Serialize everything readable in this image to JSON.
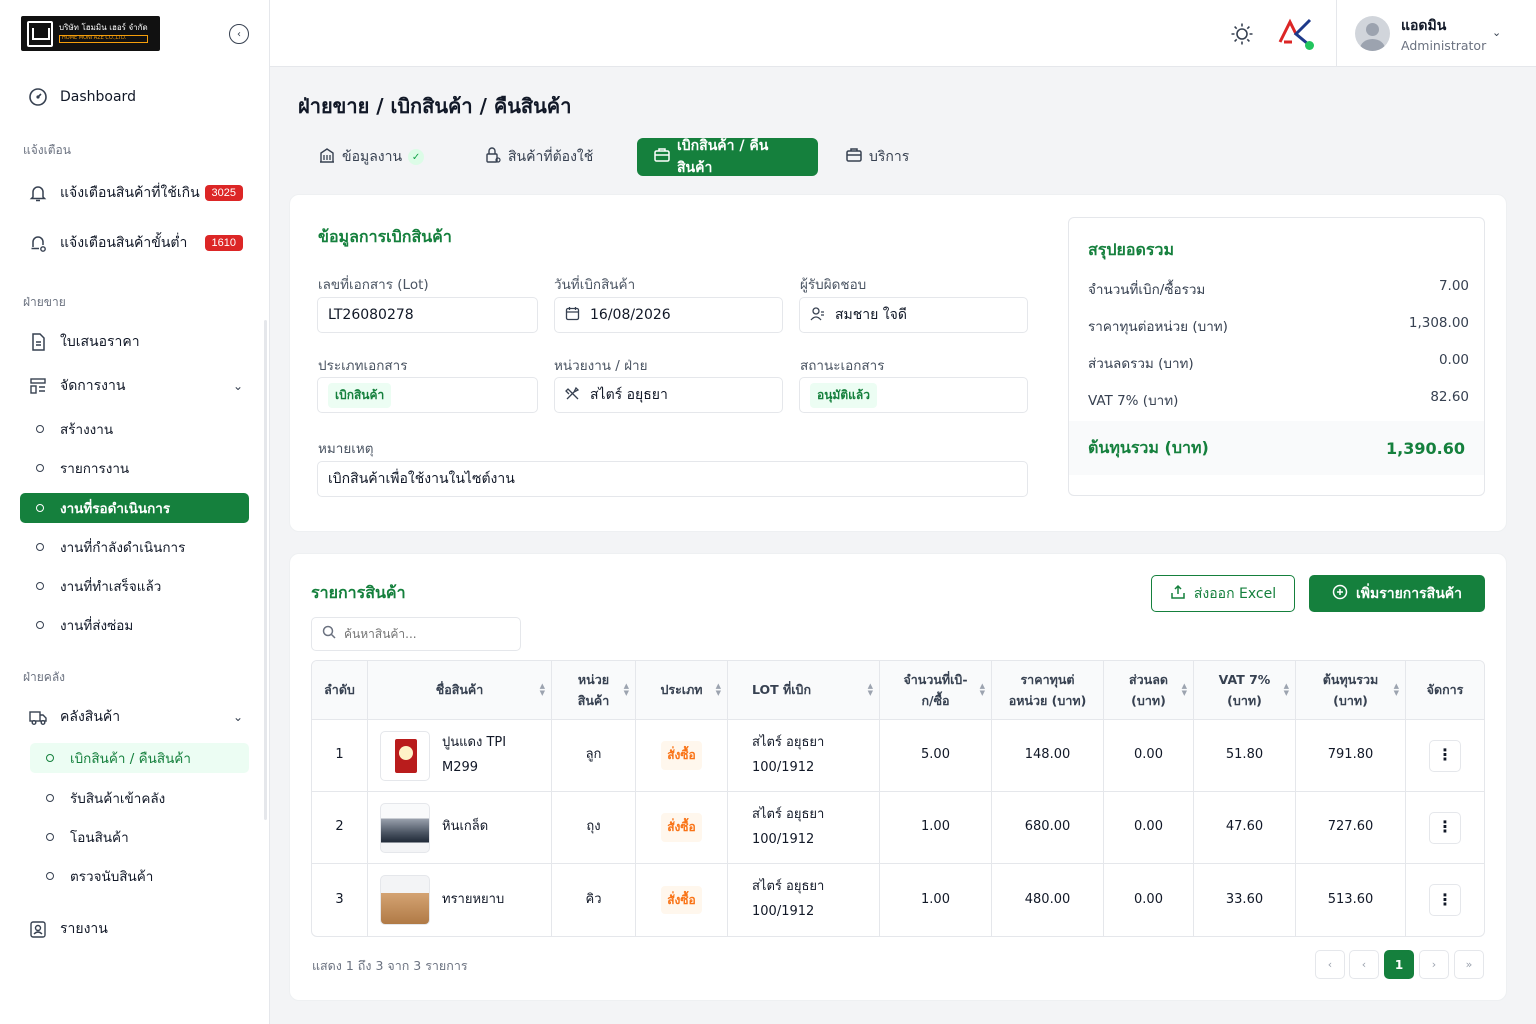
{
  "company": {
    "name_line1": "บริษัท โฮมมิน เฮอร์ จำกัด",
    "name_line2": "HOME MONI AZE CO.,LTD."
  },
  "sidebar": {
    "dashboard": "Dashboard",
    "section_alerts": "แจ้งเตือน",
    "alert_overuse": {
      "label": "แจ้งเตือนสินค้าที่ใช้เกิน",
      "count": "3025"
    },
    "alert_min": {
      "label": "แจ้งเตือนสินค้าขั้นต่ำ",
      "count": "1610"
    },
    "section_sales": "ฝ่ายขาย",
    "quotation": "ใบเสนอราคา",
    "manage_jobs": "จัดการงาน",
    "jobs": [
      "สร้างงาน",
      "รายการงาน",
      "งานที่รอดำเนินการ",
      "งานที่กำลังดำเนินการ",
      "งานที่ทำเสร็จแล้ว",
      "งานที่ส่งซ่อม"
    ],
    "section_warehouse": "ฝ่ายคลัง",
    "warehouse": "คลังสินค้า",
    "warehouse_items": [
      "เบิกสินค้า / คืนสินค้า",
      "รับสินค้าเข้าคลัง",
      "โอนสินค้า",
      "ตรวจนับสินค้า"
    ],
    "report": "รายงาน"
  },
  "user": {
    "name": "แอดมิน",
    "role": "Administrator"
  },
  "page": {
    "title": "ฝ่ายขาย / เบิกสินค้า / คืนสินค้า",
    "tabs": [
      "ข้อมูลงาน",
      "สินค้าที่ต้องใช้",
      "เบิกสินค้า / คืนสินค้า",
      "บริการ"
    ]
  },
  "info": {
    "title": "ข้อมูลการเบิกสินค้า",
    "lot_label": "เลขที่เอกสาร (Lot)",
    "lot_value": "LT26080278",
    "date_label": "วันที่เบิกสินค้า",
    "date_value": "16/08/2026",
    "owner_label": "ผู้รับผิดชอบ",
    "owner_value": "สมชาย ใจดี",
    "doctype_label": "ประเภทเอกสาร",
    "doctype_value": "เบิกสินค้า",
    "dept_label": "หน่วยงาน / ฝ่าย",
    "dept_value": "สไตร์ อยุธยา",
    "status_label": "สถานะเอกสาร",
    "status_value": "อนุมัติแล้ว",
    "note_label": "หมายเหตุ",
    "note_value": "เบิกสินค้าเพื่อใช้งานในไซต์งาน"
  },
  "summary": {
    "title": "สรุปยอดรวม",
    "rows": [
      {
        "label": "จำนวนที่เบิก/ซื้อรวม",
        "value": "7.00"
      },
      {
        "label": "ราคาทุนต่อหน่วย (บาท)",
        "value": "1,308.00"
      },
      {
        "label": "ส่วนลดรวม (บาท)",
        "value": "0.00"
      },
      {
        "label": "VAT 7% (บาท)",
        "value": "82.60"
      }
    ],
    "total_label": "ต้นทุนรวม (บาท)",
    "total_value": "1,390.60"
  },
  "items": {
    "title": "รายการสินค้า",
    "export_label": "ส่งออก Excel",
    "add_label": "เพิ่มรายการสินค้า",
    "search_placeholder": "ค้นหาสินค้า...",
    "headers": [
      "ลำดับ",
      "ชื่อสินค้า",
      "หน่วยสินค้า",
      "ประเภท",
      "LOT ที่เบิก",
      "จำนวนที่เบิก/ซื้อ",
      "ราคาทุนต่อหน่วย (บาท)",
      "ส่วนลด (บาท)",
      "VAT 7% (บาท)",
      "ต้นทุนรวม (บาท)",
      "จัดการ"
    ],
    "headers_l1": [
      "ลำดับ",
      "ชื่อสินค้า",
      "หน่วย",
      "ประเภท",
      "LOT ที่เบิก",
      "จำนวนที่เบิ-",
      "ราคาทุนต่",
      "ส่วนลด",
      "VAT 7%",
      "ต้นทุนรวม",
      "จัดการ"
    ],
    "headers_l2": [
      "",
      "",
      "สินค้า",
      "",
      "",
      "ก/ซื้อ",
      "อหน่วย (บาท)",
      "(บาท)",
      "(บาท)",
      "(บาท)",
      ""
    ],
    "rows": [
      {
        "no": "1",
        "name1": "ปูนแดง TPI",
        "name2": "M299",
        "unit": "ลูก",
        "type": "สั่งซื้อ",
        "lot1": "สไตร์ อยุธยา",
        "lot2": "100/1912",
        "qty": "5.00",
        "cost": "148.00",
        "disc": "0.00",
        "vat": "51.80",
        "total": "791.80",
        "img": "cement-bag"
      },
      {
        "no": "2",
        "name1": "หินเกล็ด",
        "name2": "",
        "unit": "ถุง",
        "type": "สั่งซื้อ",
        "lot1": "สไตร์ อยุธยา",
        "lot2": "100/1912",
        "qty": "1.00",
        "cost": "680.00",
        "disc": "0.00",
        "vat": "47.60",
        "total": "727.60",
        "img": "pipes"
      },
      {
        "no": "3",
        "name1": "ทรายหยาบ",
        "name2": "",
        "unit": "คิว",
        "type": "สั่งซื้อ",
        "lot1": "สไตร์ อยุธยา",
        "lot2": "100/1912",
        "qty": "1.00",
        "cost": "480.00",
        "disc": "0.00",
        "vat": "33.60",
        "total": "513.60",
        "img": "sand"
      }
    ],
    "footer": "แสดง 1 ถึง 3 จาก 3 รายการ",
    "page_current": "1"
  },
  "colors": {
    "primary": "#15803d",
    "badge": "#dc2626",
    "tag_orange": "#f97316"
  },
  "icons": [
    "dashboard-icon",
    "bell-icon",
    "document-icon",
    "list-icon",
    "truck-icon",
    "report-icon",
    "sun-icon",
    "search-icon",
    "calendar-icon",
    "user-icon",
    "tools-icon",
    "upload-icon",
    "plus-circle-icon",
    "kebab-icon"
  ]
}
